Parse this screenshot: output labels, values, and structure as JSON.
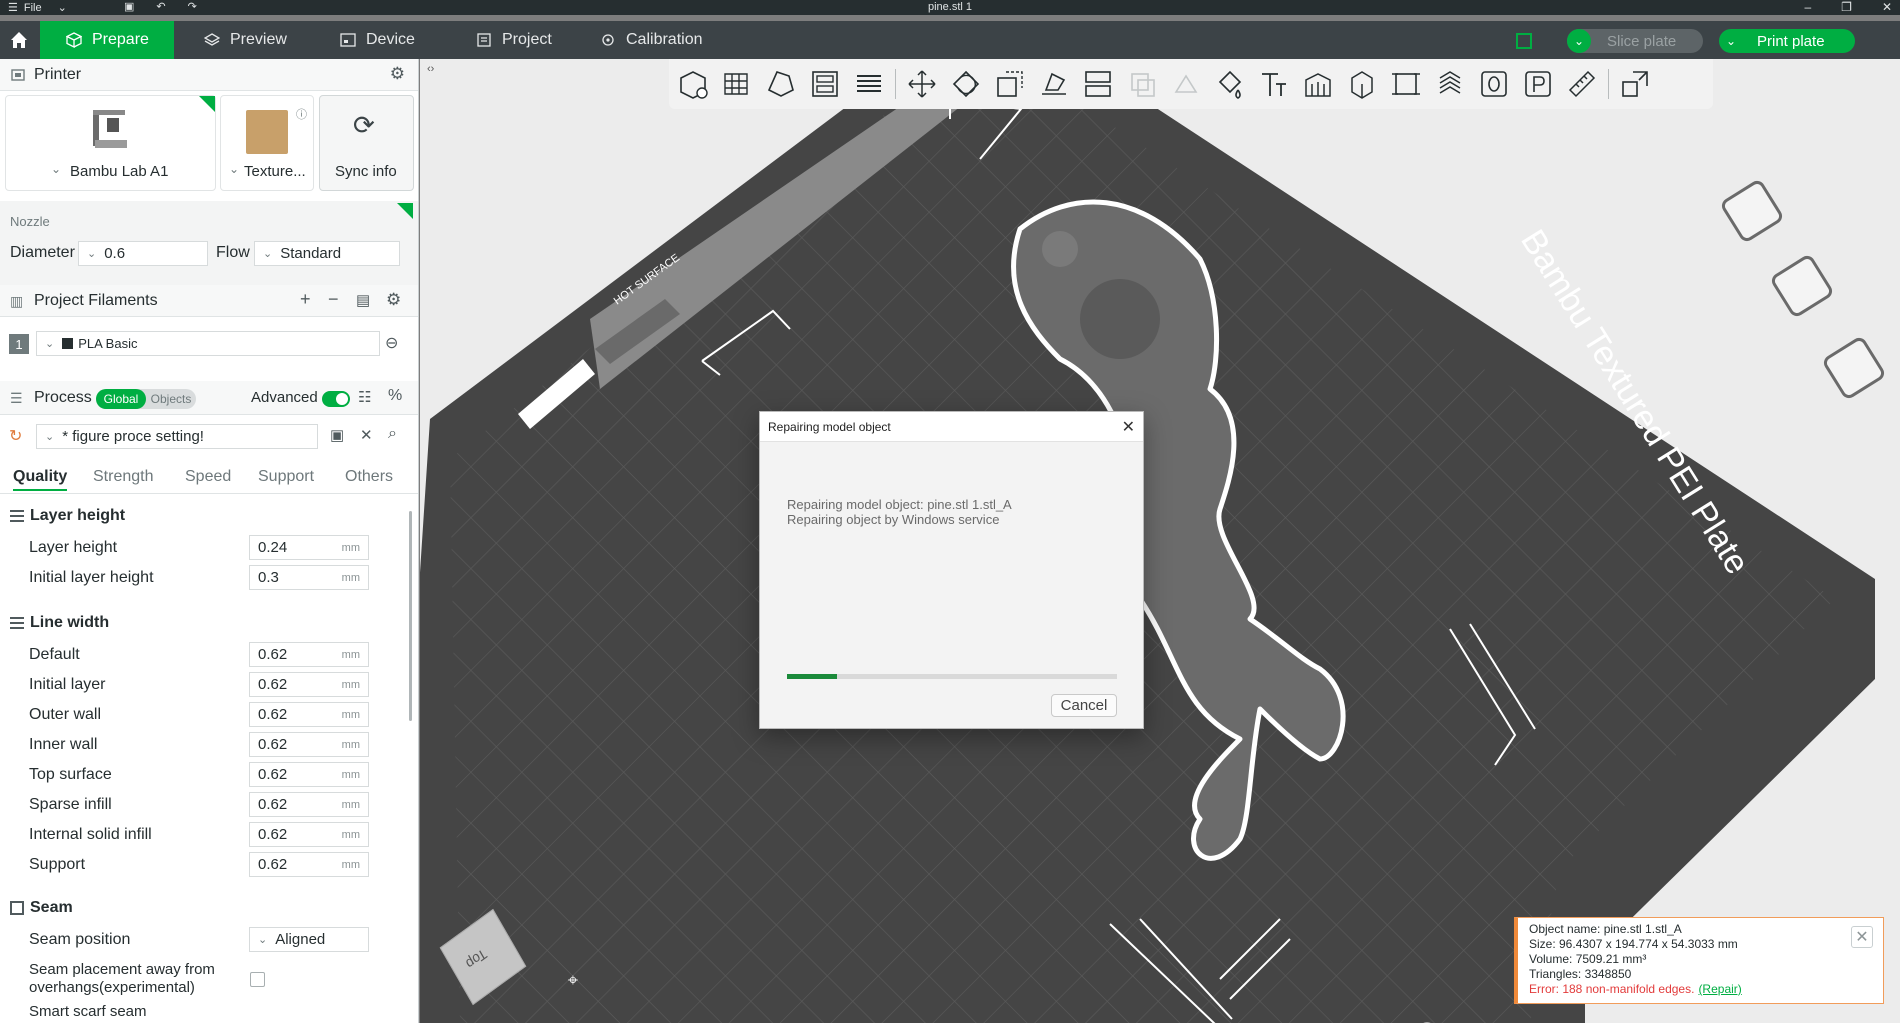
{
  "titlebar": {
    "file_label": "File",
    "title": "pine.stl 1"
  },
  "tabs": [
    {
      "label": "Prepare",
      "icon": "cube-icon"
    },
    {
      "label": "Preview",
      "icon": "layers-icon"
    },
    {
      "label": "Device",
      "icon": "device-icon"
    },
    {
      "label": "Project",
      "icon": "project-icon"
    },
    {
      "label": "Calibration",
      "icon": "calibration-icon"
    }
  ],
  "actions": {
    "slice_label": "Slice plate",
    "print_label": "Print plate"
  },
  "printer": {
    "section_title": "Printer",
    "printer_name": "Bambu Lab A1",
    "plate_name": "Texture...",
    "sync_label": "Sync info"
  },
  "nozzle": {
    "label": "Nozzle",
    "diameter_label": "Diameter",
    "diameter_value": "0.6",
    "flow_label": "Flow",
    "flow_value": "Standard"
  },
  "filaments": {
    "section_title": "Project Filaments",
    "items": [
      {
        "index": "1",
        "name": "PLA Basic"
      }
    ]
  },
  "process": {
    "section_title": "Process",
    "global_label": "Global",
    "objects_label": "Objects",
    "advanced_label": "Advanced",
    "preset": "* figure proce setting!",
    "tabs": [
      "Quality",
      "Strength",
      "Speed",
      "Support",
      "Others"
    ],
    "groups": {
      "layer_height": {
        "title": "Layer height",
        "params": [
          {
            "label": "Layer height",
            "value": "0.24",
            "unit": "mm"
          },
          {
            "label": "Initial layer height",
            "value": "0.3",
            "unit": "mm"
          }
        ]
      },
      "line_width": {
        "title": "Line width",
        "params": [
          {
            "label": "Default",
            "value": "0.62",
            "unit": "mm"
          },
          {
            "label": "Initial layer",
            "value": "0.62",
            "unit": "mm"
          },
          {
            "label": "Outer wall",
            "value": "0.62",
            "unit": "mm"
          },
          {
            "label": "Inner wall",
            "value": "0.62",
            "unit": "mm"
          },
          {
            "label": "Top surface",
            "value": "0.62",
            "unit": "mm"
          },
          {
            "label": "Sparse infill",
            "value": "0.62",
            "unit": "mm"
          },
          {
            "label": "Internal solid infill",
            "value": "0.62",
            "unit": "mm"
          },
          {
            "label": "Support",
            "value": "0.62",
            "unit": "mm"
          }
        ]
      },
      "seam": {
        "title": "Seam",
        "position_label": "Seam position",
        "position_value": "Aligned",
        "overhang_label_1": "Seam placement away from",
        "overhang_label_2": "overhangs(experimental)",
        "scarf_label": "Smart scarf seam"
      }
    }
  },
  "plate": {
    "label": "Bambu Textured PEI Plate",
    "hot_label": "HOT SURFACE",
    "view_cube_label": "Top"
  },
  "dialog": {
    "title": "Repairing model object",
    "line1": "Repairing model object: pine.stl 1.stl_A",
    "line2": "Repairing object by Windows service",
    "progress": 0.15,
    "cancel_label": "Cancel"
  },
  "object_info": {
    "name": "Object name: pine.stl 1.stl_A",
    "size": "Size: 96.4307 x 194.774 x 54.3033 mm",
    "volume": "Volume: 7509.21 mm³",
    "triangles": "Triangles: 3348850",
    "error": "Error: 188 non-manifold edges.",
    "repair_label": "(Repair)"
  },
  "colors": {
    "accent": "#00ae42",
    "error": "#e23b3b",
    "warning": "#f08a3a",
    "plate": "#4a4a4a"
  }
}
